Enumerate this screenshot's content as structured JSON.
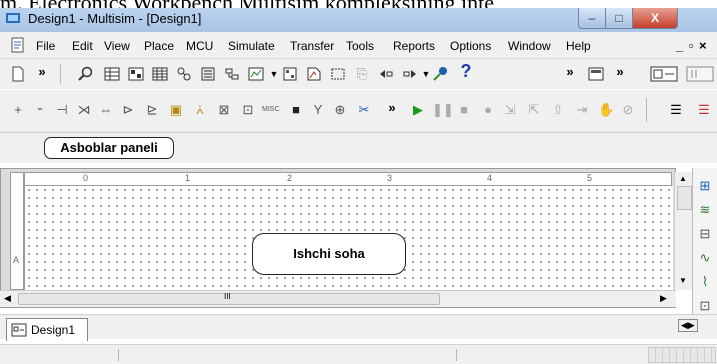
{
  "background_doc_text": "m. Electronics Workbench Multisim kompleksining inte",
  "window": {
    "title": "Design1 - Multisim - [Design1]",
    "minimize_label": "–",
    "maximize_label": "□",
    "close_label": "X"
  },
  "menu": {
    "items": [
      "File",
      "Edit",
      "View",
      "Place",
      "MCU",
      "Simulate",
      "Transfer",
      "Tools",
      "Reports",
      "Options",
      "Window",
      "Help"
    ],
    "mdi_controls": "_ ⁠ ⁠ ⁠ × "
  },
  "toolbar": {
    "overflow_label": "»"
  },
  "callouts": {
    "toolbar_label": "Asboblar paneli",
    "workspace_label": "Ishchi soha"
  },
  "ruler": {
    "ticks": [
      "0",
      "1",
      "2",
      "3",
      "4",
      "5"
    ],
    "row_label": "A"
  },
  "scrollbar": {
    "thumb_label": "III"
  },
  "tabs": {
    "active": "Design1"
  },
  "colors": {
    "titlebar": "#bcd3ee",
    "close_button": "#c33f2a",
    "play_green": "#1a9a1a"
  }
}
